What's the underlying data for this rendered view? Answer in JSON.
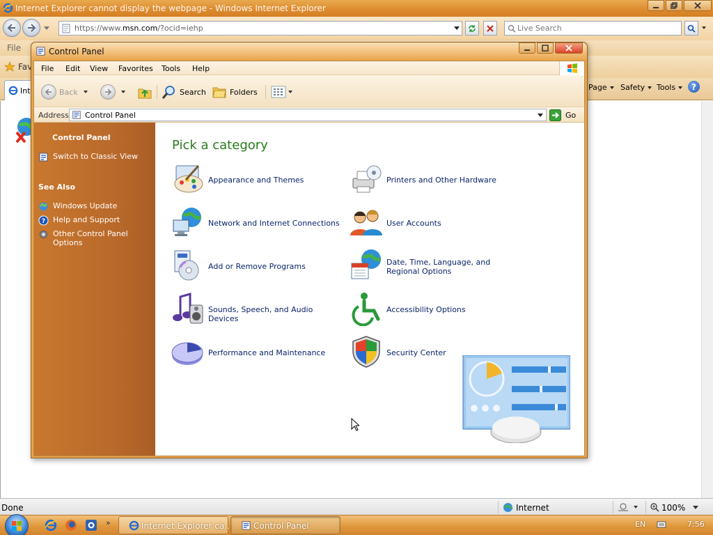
{
  "ie": {
    "title": "Internet Explorer cannot display the webpage - Windows Internet Explorer",
    "url_prefix": "https://www.",
    "url_domain": "msn.com",
    "url_suffix": "/?ocid=iehp",
    "search_placeholder": "Live Search",
    "menu_file": "File",
    "favorites_label": "Fav",
    "tab_label": "Int",
    "commands": {
      "page": "Page",
      "safety": "Safety",
      "tools": "Tools"
    },
    "status_done": "Done",
    "zone": "Internet",
    "zoom": "100%"
  },
  "taskbar": {
    "tasks": [
      {
        "label": "Internet Explorer ca..."
      },
      {
        "label": "Control Panel"
      }
    ],
    "lang": "EN",
    "clock": "7:56",
    "chevron": "»"
  },
  "cp": {
    "title": "Control Panel",
    "menu": [
      "File",
      "Edit",
      "View",
      "Favorites",
      "Tools",
      "Help"
    ],
    "toolbar": {
      "back": "Back",
      "search": "Search",
      "folders": "Folders"
    },
    "address_label": "Address",
    "address_value": "Control Panel",
    "go": "Go",
    "sidebar": {
      "panel_title": "Control Panel",
      "switch_view": "Switch to Classic View",
      "see_also": "See Also",
      "links": [
        "Windows Update",
        "Help and Support",
        "Other Control Panel Options"
      ]
    },
    "heading": "Pick a category",
    "categories": [
      {
        "label": "Appearance and Themes"
      },
      {
        "label": "Printers and Other Hardware"
      },
      {
        "label": "Network and Internet Connections"
      },
      {
        "label": "User Accounts"
      },
      {
        "label": "Add or Remove Programs"
      },
      {
        "label": "Date, Time, Language, and Regional Options"
      },
      {
        "label": "Sounds, Speech, and Audio Devices"
      },
      {
        "label": "Accessibility Options"
      },
      {
        "label": "Performance and Maintenance"
      },
      {
        "label": "Security Center"
      }
    ]
  },
  "colors": {
    "accent_orange": "#e8a349",
    "sidebar": "#b8682a",
    "heading_green": "#2a7a1e",
    "link_blue": "#0a246a"
  }
}
